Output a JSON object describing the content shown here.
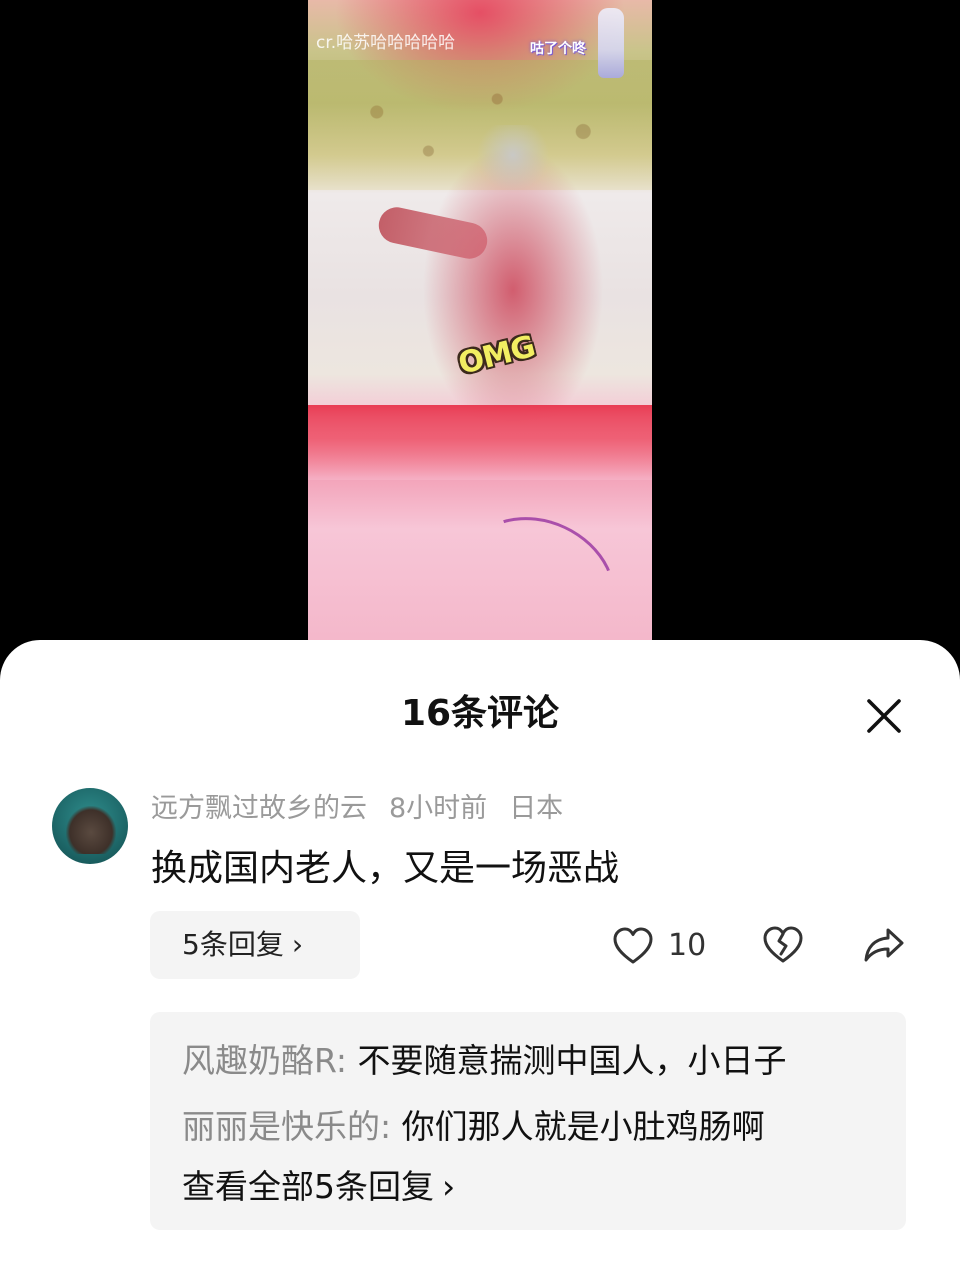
{
  "video": {
    "credit_text": "cr.哈苏哈哈哈哈哈",
    "sticker_tag": "咕了个咚",
    "overlay_text": "OMG"
  },
  "comments_panel": {
    "title": "16条评论",
    "close_icon": "close-icon"
  },
  "comment": {
    "username": "远方飘过故乡的云",
    "time": "8小时前",
    "location": "日本",
    "text": "换成国内老人，又是一场恶战",
    "reply_button_label": "5条回复",
    "reply_chevron": "›",
    "like_count": "10",
    "icons": [
      "heart-icon",
      "broken-heart-icon",
      "share-icon"
    ]
  },
  "replies": [
    {
      "author": "风趣奶酪R",
      "separator": ": ",
      "text": "不要随意揣测中国人，小日子"
    },
    {
      "author": "丽丽是快乐的",
      "separator": ": ",
      "text": "你们那人就是小肚鸡肠啊"
    }
  ],
  "view_all_label": "查看全部5条回复",
  "view_all_chevron": "›",
  "colors": {
    "sheet_background": "#ffffff",
    "reply_box_background": "#f4f4f4",
    "meta_text": "#9a9a9a",
    "reply_author": "#8a8a8a",
    "primary_text": "#111111"
  }
}
